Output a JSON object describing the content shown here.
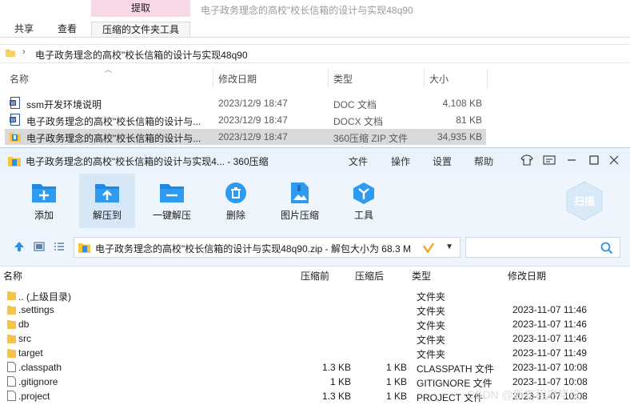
{
  "explorer": {
    "context_tab": "提取",
    "window_title": "电子政务理念的高校\"校长信箱的设计与实现48q90",
    "tabs": [
      "共享",
      "查看",
      "压缩的文件夹工具"
    ],
    "address": "电子政务理念的高校\"校长信箱的设计与实现48q90",
    "columns": {
      "name": "名称",
      "date": "修改日期",
      "type": "类型",
      "size": "大小"
    },
    "files": [
      {
        "name": "ssm开发环境说明",
        "date": "2023/12/9 18:47",
        "type": "DOC 文档",
        "size": "4,108 KB",
        "icon": "word-doc-icon"
      },
      {
        "name": "电子政务理念的高校\"校长信箱的设计与...",
        "date": "2023/12/9 18:47",
        "type": "DOCX 文档",
        "size": "81 KB",
        "icon": "word-docx-icon"
      },
      {
        "name": "电子政务理念的高校\"校长信箱的设计与...",
        "date": "2023/12/9 18:47",
        "type": "360压缩 ZIP 文件",
        "size": "34,935 KB",
        "icon": "zip-archive-icon"
      }
    ]
  },
  "zip": {
    "title": "电子政务理念的高校\"校长信箱的设计与实现4... - 360压缩",
    "menu": [
      "文件",
      "操作",
      "设置",
      "帮助"
    ],
    "toolbar": [
      {
        "label": "添加",
        "icon": "add-icon"
      },
      {
        "label": "解压到",
        "icon": "extract-to-icon"
      },
      {
        "label": "一键解压",
        "icon": "one-click-extract-icon"
      },
      {
        "label": "删除",
        "icon": "delete-icon"
      },
      {
        "label": "图片压缩",
        "icon": "image-compress-icon"
      },
      {
        "label": "工具",
        "icon": "tools-icon"
      }
    ],
    "scan_label": "扫描",
    "path": "电子政务理念的高校\"校长信箱的设计与实现48q90.zip - 解包大小为 68.3 M",
    "columns": {
      "name": "名称",
      "compressed": "压缩前",
      "after": "压缩后",
      "type": "类型",
      "modified": "修改日期"
    },
    "rows": [
      {
        "name": ".. (上级目录)",
        "before": "",
        "after": "",
        "type": "文件夹",
        "date": "",
        "kind": "folder"
      },
      {
        "name": ".settings",
        "before": "",
        "after": "",
        "type": "文件夹",
        "date": "2023-11-07 11:46",
        "kind": "folder"
      },
      {
        "name": "db",
        "before": "",
        "after": "",
        "type": "文件夹",
        "date": "2023-11-07 11:46",
        "kind": "folder"
      },
      {
        "name": "src",
        "before": "",
        "after": "",
        "type": "文件夹",
        "date": "2023-11-07 11:46",
        "kind": "folder"
      },
      {
        "name": "target",
        "before": "",
        "after": "",
        "type": "文件夹",
        "date": "2023-11-07 11:49",
        "kind": "folder"
      },
      {
        "name": ".classpath",
        "before": "1.3 KB",
        "after": "1 KB",
        "type": "CLASSPATH 文件",
        "date": "2023-11-07 10:08",
        "kind": "file"
      },
      {
        "name": ".gitignore",
        "before": "1 KB",
        "after": "1 KB",
        "type": "GITIGNORE 文件",
        "date": "2023-11-07 10:08",
        "kind": "file"
      },
      {
        "name": ".project",
        "before": "1.3 KB",
        "after": "1 KB",
        "type": "PROJECT 文件",
        "date": "2023-11-07 10:08",
        "kind": "file"
      }
    ]
  },
  "watermark": "CSDN @新布程序毕设",
  "colors": {
    "accent": "#2f8fe0",
    "context_tab": "#f8d7e6",
    "selection": "#d9d9d9",
    "folder": "#f5c445"
  }
}
